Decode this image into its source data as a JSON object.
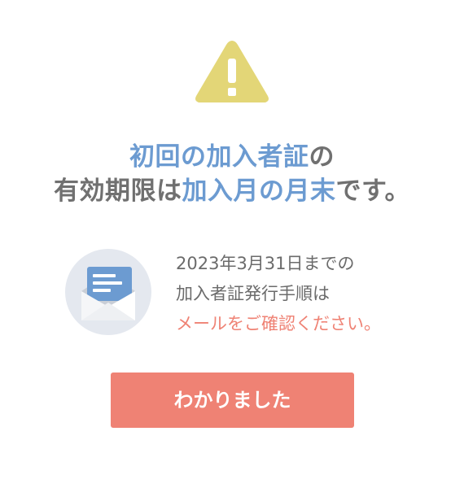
{
  "headline": {
    "line1_highlight": "初回の加入者証",
    "line1_rest": "の",
    "line2_start": "有効期限は",
    "line2_highlight": "加入月の月末",
    "line2_end": "です。"
  },
  "info": {
    "line1": "2023年3月31日までの",
    "line2": "加入者証発行手順は",
    "line3": "メールをご確認ください。"
  },
  "button": {
    "label": "わかりました"
  },
  "colors": {
    "accent_blue": "#6c9bd1",
    "accent_red": "#ef8274",
    "warning_yellow": "#e3d677",
    "text_gray": "#707070"
  },
  "icons": [
    "warning-icon",
    "mail-icon"
  ]
}
